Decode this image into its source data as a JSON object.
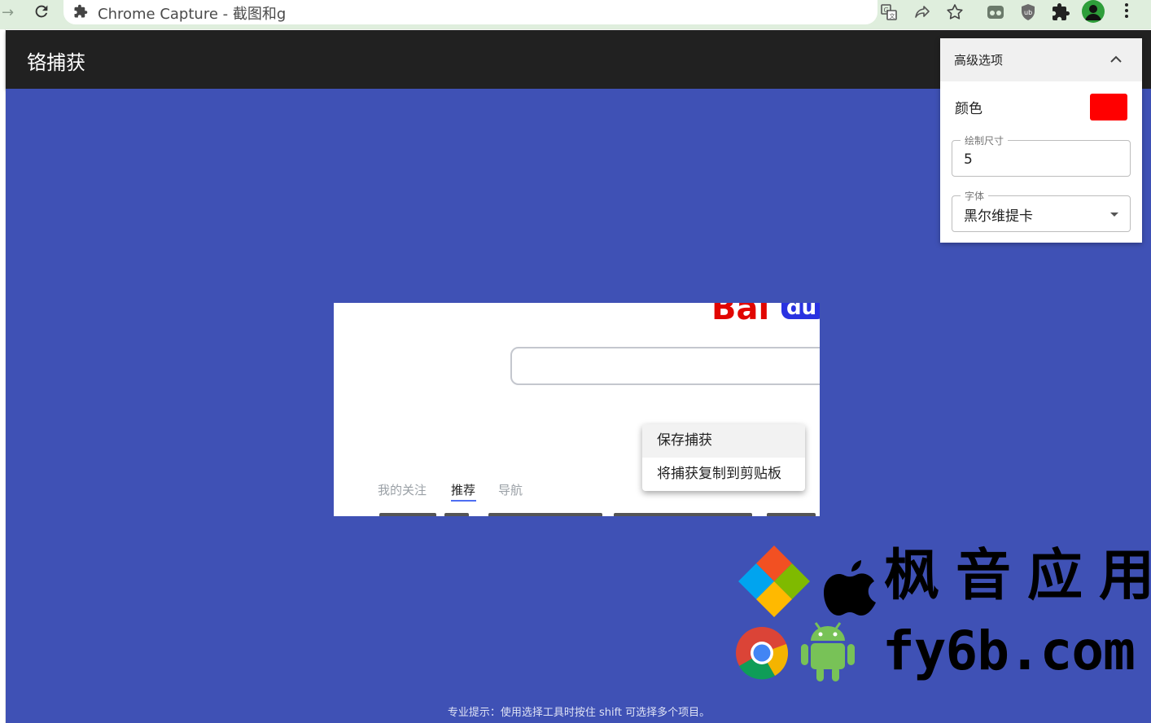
{
  "browser": {
    "tab_title": "Chrome Capture - 截图和g"
  },
  "app": {
    "title": "铬捕获"
  },
  "advanced_options": {
    "title": "高级选项",
    "color_label": "颜色",
    "color_value": "#ff0000",
    "draw_size_label": "绘制尺寸",
    "draw_size_value": "5",
    "font_label": "字体",
    "font_value": "黑尔维提卡"
  },
  "capture": {
    "tabs": [
      {
        "label": "我的关注",
        "active": false
      },
      {
        "label": "推荐",
        "active": true
      },
      {
        "label": "导航",
        "active": false
      }
    ]
  },
  "context_menu": {
    "items": [
      {
        "label": "保存捕获",
        "hovered": true
      },
      {
        "label": "将捕获复制到剪贴板",
        "hovered": false
      }
    ]
  },
  "watermark": {
    "name": "枫音应用",
    "url": "fy6b.com"
  },
  "footer": {
    "pro_tip": "专业提示：使用选择工具时按住 shift 可选择多个项目。"
  },
  "colors": {
    "header": "#212121",
    "canvas": "#3f51b5",
    "browser_bar": "#dfeedd"
  }
}
